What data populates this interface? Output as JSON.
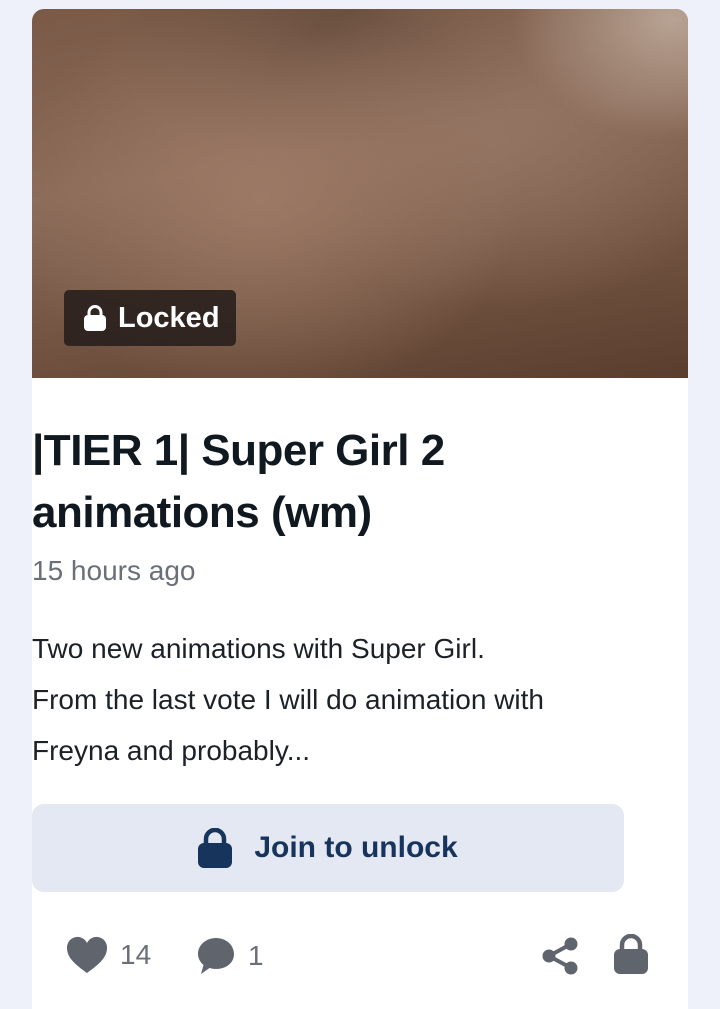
{
  "post": {
    "badge": {
      "icon": "lock-icon",
      "label": "Locked"
    },
    "title": "|TIER 1| Super Girl 2 animations (wm)",
    "timestamp": "15 hours ago",
    "description_lines": [
      "Two new animations with Super Girl.",
      "From the last vote I will do animation with",
      "Freyna and probably..."
    ],
    "join_button": {
      "icon": "lock-icon",
      "label": "Join to unlock"
    },
    "footer": {
      "likes": {
        "icon": "heart-icon",
        "count": "14"
      },
      "comments": {
        "icon": "comment-icon",
        "count": "1"
      },
      "share": {
        "icon": "share-icon"
      },
      "lock": {
        "icon": "lock-icon"
      }
    }
  },
  "colors": {
    "page_background": "#eef1fa",
    "card_background": "#ffffff",
    "button_background": "#e3e8f3",
    "button_text": "#17345c",
    "muted_text": "#6b6f78"
  }
}
